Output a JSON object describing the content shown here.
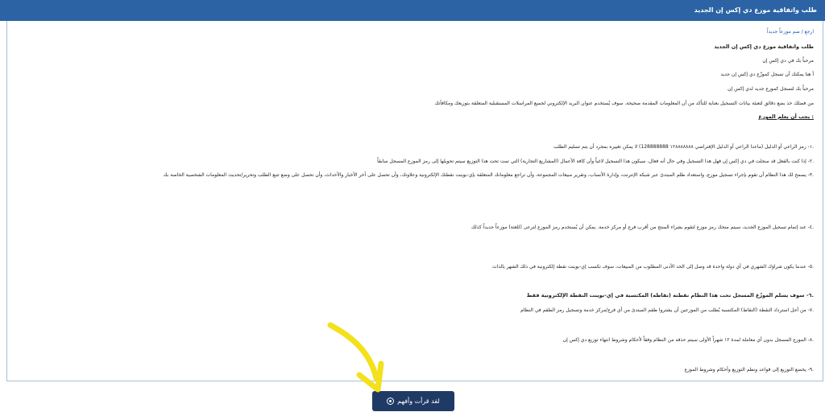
{
  "header": {
    "title": "طلب واتفاقية موزع دي إكس إن الجديد"
  },
  "content": {
    "back_link": "ارجع / ضم موزعاً جديداً",
    "heading": "طلب واتفاقية موزع دي إكس إن الجديد",
    "welcome_1": "مرحباً بك في دي إكس إن",
    "intro_line": "أ هنا يمكنك أن تسجل كموزّع دي إكس إن جديد",
    "welcome_2": "مرحباً بك لتسجل كموزع جديد لدي إكس إن",
    "note": "من فضلك خذ بضع دقائق لتعبئة بيانات التسجيل بعناية للتأكد من أن المعلومات المقدمة صحيحة. سوف يُستخدم عنوان البريد الإلكتروني لجميع المراسلات المستقبلية المتعلقة بتوزيعك ومكافآتك",
    "must_know": ": يجب أن يعلم الموزع",
    "terms": [
      ".١- رمز الراعي أو الدليل (ماعدا الراعي أو الدليل الإفتراضي ١٢٨٨٨٨٨٨٨ 128888888) لا يمكن تغييره بمجرد أن يتم تسليم الطلب",
      ".٢- إذا كنت بالفعل قد سجلت في دي إكس إن فهل هذا التسجيل وفي حال أنه فعال، سيكون هذا التسجيل لاغياً وأن كافة الأعمال (المشاريع التجارية) التي تمت تحت هذا التوزيع سيتم تحويلها إلى رمز الموزع المسجل سابقاً",
      ".٣- يسمح لك هذا النظام أن تقوم بإجراء تسجيل موزع، واستعداد طلم المبتدئ عبر شبكة الإنترنت، وإدارة الأنساب، وتقرير مبيعات المجموعة، وأن تراجع معلوماتك المتعلقة بإي-بوينت نقطتك الإلكترونية وعلاوتك، وأن تحصل على آخر الأخبار والأحداث، وأن تحصل على وضع تتبع الطلب وتحرير/تحديث المعلومات الشخصية الخاصة بك",
      ".٤- عند إتمام تسجيل الموزع الجديد، سيتم منحك رمز موزع لتقوم بشراء المنتج من أقرب فرع أو مركز خدمة. يمكن أن يُستخدم رمز الموزع لترعى (للعثة) موزعاً جديداً كذلك",
      ".٥- عندما يكون شراؤك الشهري في أي دولة واحدة قد وصل إلى الحد الأدنى المطلوب من المبيعات، سوف تكسب إي-بوينت نقطة إلكترونية في ذلك الشهر بالذات",
      ".٦- سوف يسلم الموزّع المسجل تحت هذا النظام نقطته (نقاطه) المكتسبة في إي-بوينت النقطة الإلكترونية فقط",
      ".٧- من أجل استرداد النقطة (النقاط) المكتسبة يُطلب من الموزعين أن يشتروا طقم المبتدئ من أي فرع/مركز خدمة وتسجيل رمز الطقم في النظام",
      ".٨- الموزع المسجل بدون أي معاملة لمدة ١٢ شهراً الأولى سيتم حذفه من النظام وفقاً لأحكام وشروط انتهاء توزيع دي إكس إن",
      ".٩- يخضع التوزيع إلى قواعد ونظم التوزيع وأحكام وشروط الموزع"
    ]
  },
  "footer": {
    "agree_label": "لقد قرأت وأفهم"
  },
  "colors": {
    "header": "#2b63a5",
    "button": "#1f3a64",
    "annotation_arrow": "#f2e11b"
  }
}
